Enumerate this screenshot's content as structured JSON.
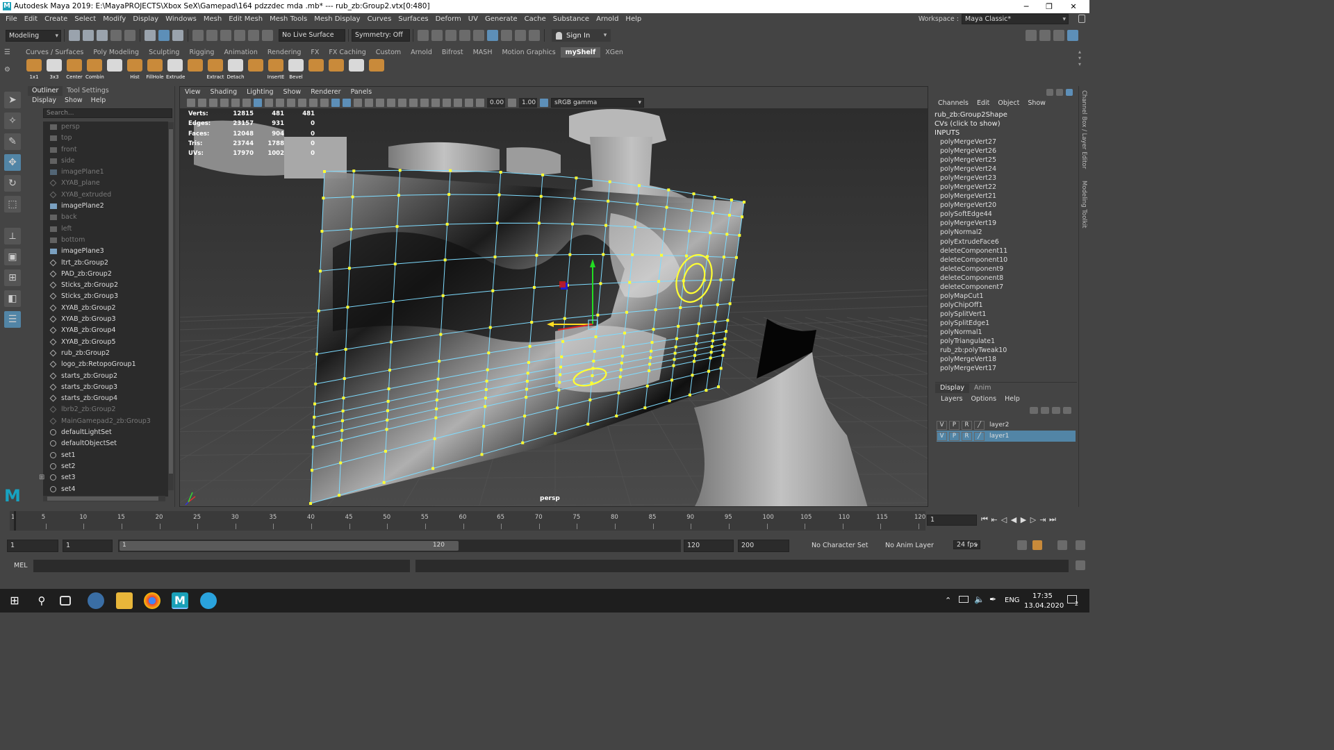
{
  "title_bar": {
    "title": "Autodesk Maya 2019: E:\\MayaPROJECTS\\Xbox SeX\\Gamepad\\164 pdzzdec mda .mb*   ---   rub_zb:Group2.vtx[0:480]",
    "minimize": "─",
    "restore": "❐",
    "close": "✕"
  },
  "menu_bar": {
    "items": [
      "File",
      "Edit",
      "Create",
      "Select",
      "Modify",
      "Display",
      "Windows",
      "Mesh",
      "Edit Mesh",
      "Mesh Tools",
      "Mesh Display",
      "Curves",
      "Surfaces",
      "Deform",
      "UV",
      "Generate",
      "Cache",
      "Substance",
      "Arnold",
      "Help"
    ],
    "workspace_label": "Workspace :",
    "workspace_value": "Maya Classic*"
  },
  "status_line": {
    "menuset": "Modeling",
    "live_surface": "No Live Surface",
    "symmetry": "Symmetry: Off",
    "sign_in": "Sign In"
  },
  "shelf": {
    "tabs": [
      "Curves / Surfaces",
      "Poly Modeling",
      "Sculpting",
      "Rigging",
      "Animation",
      "Rendering",
      "FX",
      "FX Caching",
      "Custom",
      "Arnold",
      "Bifrost",
      "MASH",
      "Motion Graphics",
      "myShelf",
      "XGen"
    ],
    "active_tab": "myShelf",
    "buttons": [
      "1x1",
      "3x3",
      "Center",
      "Combin",
      "",
      "Hist",
      "FillHole",
      "Extrude",
      "",
      "Extract",
      "Detach",
      "",
      "InsertE",
      "Bevel",
      "",
      "",
      "",
      ""
    ]
  },
  "outliner": {
    "tabs": [
      "Outliner",
      "Tool Settings"
    ],
    "menus": [
      "Display",
      "Show",
      "Help"
    ],
    "search_placeholder": "Search...",
    "items": [
      {
        "label": "persp",
        "kind": "camera",
        "dim": true
      },
      {
        "label": "top",
        "kind": "camera",
        "dim": true
      },
      {
        "label": "front",
        "kind": "camera",
        "dim": true
      },
      {
        "label": "side",
        "kind": "camera",
        "dim": true
      },
      {
        "label": "imagePlane1",
        "kind": "plane",
        "dim": true
      },
      {
        "label": "XYAB_plane",
        "kind": "grp",
        "dim": true
      },
      {
        "label": "XYAB_extruded",
        "kind": "grp",
        "dim": true
      },
      {
        "label": "imagePlane2",
        "kind": "plane",
        "dim": false
      },
      {
        "label": "back",
        "kind": "camera",
        "dim": true
      },
      {
        "label": "left",
        "kind": "camera",
        "dim": true
      },
      {
        "label": "bottom",
        "kind": "camera",
        "dim": true
      },
      {
        "label": "imagePlane3",
        "kind": "plane",
        "dim": false
      },
      {
        "label": "ltrt_zb:Group2",
        "kind": "grp",
        "dim": false
      },
      {
        "label": "PAD_zb:Group2",
        "kind": "grp",
        "dim": false
      },
      {
        "label": "Sticks_zb:Group2",
        "kind": "grp",
        "dim": false
      },
      {
        "label": "Sticks_zb:Group3",
        "kind": "grp",
        "dim": false
      },
      {
        "label": "XYAB_zb:Group2",
        "kind": "grp",
        "dim": false
      },
      {
        "label": "XYAB_zb:Group3",
        "kind": "grp",
        "dim": false
      },
      {
        "label": "XYAB_zb:Group4",
        "kind": "grp",
        "dim": false
      },
      {
        "label": "XYAB_zb:Group5",
        "kind": "grp",
        "dim": false
      },
      {
        "label": "rub_zb:Group2",
        "kind": "grp",
        "dim": false
      },
      {
        "label": "logo_zb:RetopoGroup1",
        "kind": "grp",
        "dim": false
      },
      {
        "label": "starts_zb:Group2",
        "kind": "grp",
        "dim": false
      },
      {
        "label": "starts_zb:Group3",
        "kind": "grp",
        "dim": false
      },
      {
        "label": "starts_zb:Group4",
        "kind": "grp",
        "dim": false
      },
      {
        "label": "lbrb2_zb:Group2",
        "kind": "grp",
        "dim": true
      },
      {
        "label": "MainGamepad2_zb:Group3",
        "kind": "grp",
        "dim": true
      },
      {
        "label": "defaultLightSet",
        "kind": "set",
        "dim": false
      },
      {
        "label": "defaultObjectSet",
        "kind": "set",
        "dim": false
      },
      {
        "label": "set1",
        "kind": "set",
        "dim": false
      },
      {
        "label": "set2",
        "kind": "set",
        "dim": false
      },
      {
        "label": "set3",
        "kind": "set",
        "dim": false,
        "expandable": true
      },
      {
        "label": "set4",
        "kind": "set",
        "dim": false
      }
    ]
  },
  "viewport": {
    "menus": [
      "View",
      "Shading",
      "Lighting",
      "Show",
      "Renderer",
      "Panels"
    ],
    "near_value": "0.00",
    "gamma_value": "1.00",
    "color_space": "sRGB gamma",
    "camera": "persp",
    "hud": [
      {
        "label": "Verts:",
        "a": "12815",
        "b": "481",
        "c": "481"
      },
      {
        "label": "Edges:",
        "a": "23157",
        "b": "931",
        "c": "0"
      },
      {
        "label": "Faces:",
        "a": "12048",
        "b": "904",
        "c": "0"
      },
      {
        "label": "Tris:",
        "a": "23744",
        "b": "1788",
        "c": "0"
      },
      {
        "label": "UVs:",
        "a": "17970",
        "b": "1002",
        "c": "0"
      }
    ]
  },
  "channel_box": {
    "menus": [
      "Channels",
      "Edit",
      "Object",
      "Show"
    ],
    "shape_name": "rub_zb:Group2Shape",
    "cvs_label": "CVs (click to show)",
    "inputs_label": "INPUTS",
    "inputs": [
      "polyMergeVert27",
      "polyMergeVert26",
      "polyMergeVert25",
      "polyMergeVert24",
      "polyMergeVert23",
      "polyMergeVert22",
      "polyMergeVert21",
      "polyMergeVert20",
      "polySoftEdge44",
      "polyMergeVert19",
      "polyNormal2",
      "polyExtrudeFace6",
      "deleteComponent11",
      "deleteComponent10",
      "deleteComponent9",
      "deleteComponent8",
      "deleteComponent7",
      "polyMapCut1",
      "polyChipOff1",
      "polySplitVert1",
      "polySplitEdge1",
      "polyNormal1",
      "polyTriangulate1",
      "rub_zb:polyTweak10",
      "polyMergeVert18",
      "polyMergeVert17"
    ],
    "side_tabs": [
      "Channel Box / Layer Editor",
      "Modeling Toolkit"
    ]
  },
  "layer_editor": {
    "tabs": [
      "Display",
      "Anim"
    ],
    "menus": [
      "Layers",
      "Options",
      "Help"
    ],
    "layers": [
      {
        "v": "V",
        "p": "P",
        "r": "R",
        "name": "layer2",
        "selected": false
      },
      {
        "v": "V",
        "p": "P",
        "r": "R",
        "name": "layer1",
        "selected": true
      }
    ]
  },
  "timeline": {
    "ticks": [
      "1",
      "5",
      "10",
      "15",
      "20",
      "25",
      "30",
      "35",
      "40",
      "45",
      "50",
      "55",
      "60",
      "65",
      "70",
      "75",
      "80",
      "85",
      "90",
      "95",
      "100",
      "105",
      "110",
      "115",
      "120"
    ],
    "current_frame": "1"
  },
  "range": {
    "start": "1",
    "playback_start": "1",
    "slider_start": "1",
    "slider_end": "120",
    "playback_end": "120",
    "end": "200",
    "character_set": "No Character Set",
    "anim_layer": "No Anim Layer",
    "fps": "24 fps"
  },
  "command_line": {
    "label": "MEL"
  },
  "taskbar": {
    "language": "ENG",
    "time": "17:35",
    "date": "13.04.2020",
    "notification_count": "2"
  },
  "colors": {
    "panel": "#444444",
    "dark_field": "#2b2b2b",
    "selection_blue": "#5285a6",
    "wire_cyan": "#7fdcff",
    "vertex_yellow": "#ffff33"
  }
}
